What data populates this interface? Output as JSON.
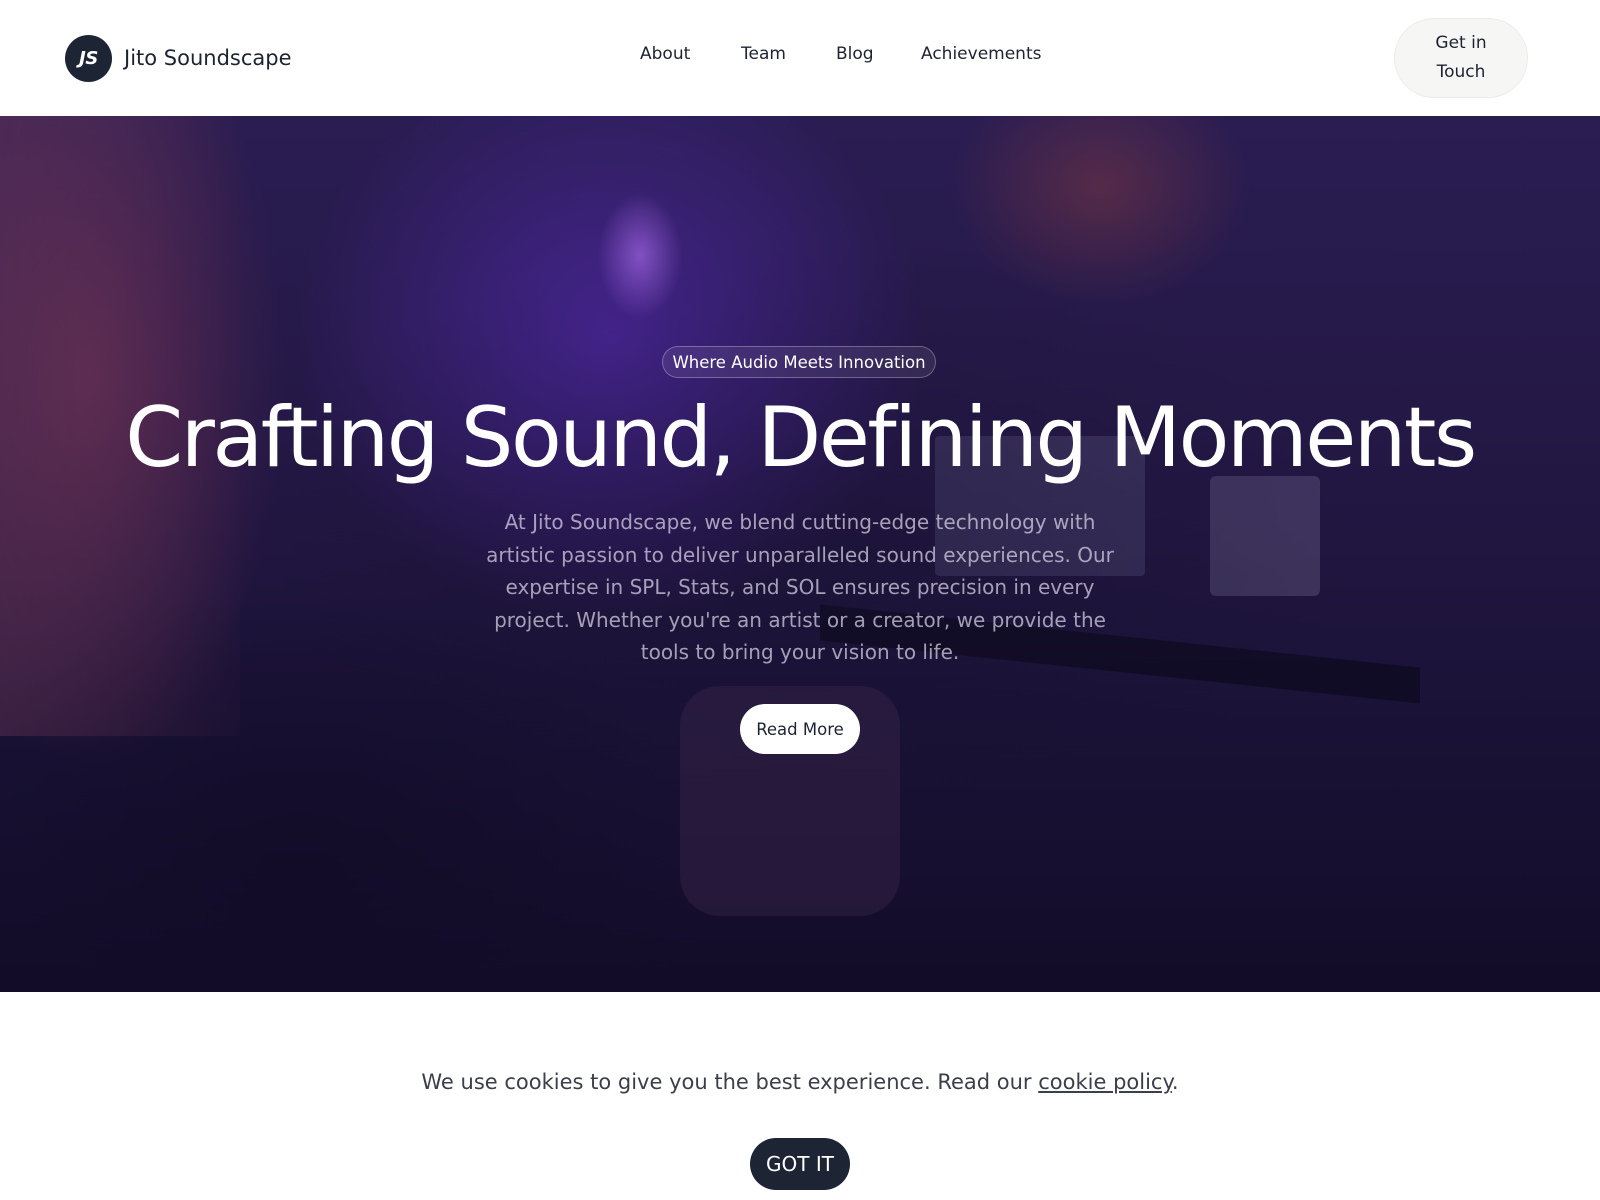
{
  "header": {
    "logo_initials": "JS",
    "brand_name": "Jito Soundscape",
    "nav": [
      {
        "label": "About"
      },
      {
        "label": "Team"
      },
      {
        "label": "Blog"
      },
      {
        "label": "Achievements"
      }
    ],
    "cta_label": "Get in Touch"
  },
  "hero": {
    "tagline": "Where Audio Meets Innovation",
    "headline": "Crafting Sound, Defining Moments",
    "description": "At Jito Soundscape, we blend cutting-edge technology with artistic passion to deliver unparalleled sound experiences. Our expertise in SPL, Stats, and SOL ensures precision in every project. Whether you're an artist or a creator, we provide the tools to bring your vision to life.",
    "button_label": "Read More"
  },
  "cookie_banner": {
    "text_before": "We use cookies to give you the best experience. Read our ",
    "link_label": "cookie policy",
    "text_after": ".",
    "button_label": "GOT IT"
  },
  "colors": {
    "brand_dark": "#1d2433",
    "hero_purple": "#2a1d52",
    "cta_background": "#f6f6f4"
  }
}
